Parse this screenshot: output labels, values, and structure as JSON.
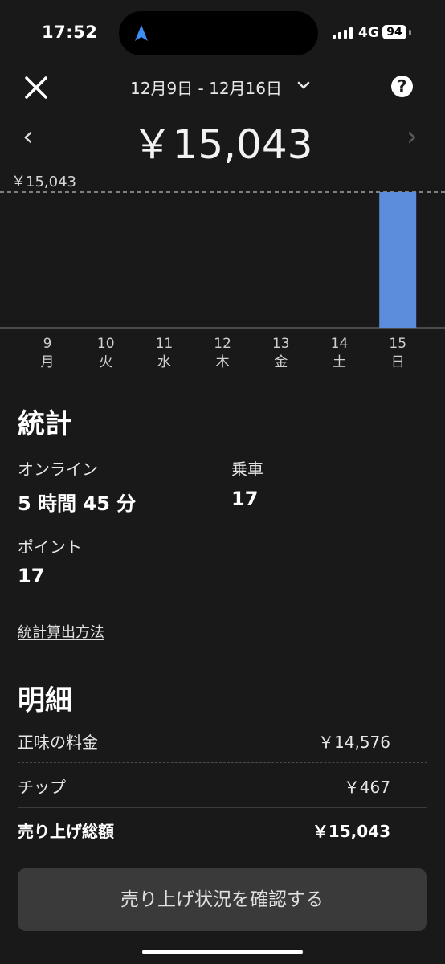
{
  "status_bar": {
    "time": "17:52",
    "network": "4G",
    "battery": "94"
  },
  "header": {
    "date_range": "12月9日 - 12月16日",
    "total": "￥15,043",
    "prev": "‹",
    "next": "›",
    "help": "?"
  },
  "chart_data": {
    "type": "bar",
    "categories": [
      "9",
      "10",
      "11",
      "12",
      "13",
      "14",
      "15"
    ],
    "weekdays": [
      "月",
      "火",
      "水",
      "木",
      "金",
      "土",
      "日"
    ],
    "values": [
      0,
      0,
      0,
      0,
      0,
      0,
      15043
    ],
    "max_label": "￥15,043",
    "ylim": [
      0,
      15043
    ],
    "bar_color": "#5b8ddc",
    "grid": false,
    "legend": "none"
  },
  "stats": {
    "title": "統計",
    "online_label": "オンライン",
    "online_value": "5 時間 45 分",
    "rides_label": "乗車",
    "rides_value": "17",
    "points_label": "ポイント",
    "points_value": "17",
    "method_link": "統計算出方法"
  },
  "breakdown": {
    "title": "明細",
    "rows": [
      {
        "label": "正味の料金",
        "value": "￥14,576"
      },
      {
        "label": "チップ",
        "value": "￥467"
      },
      {
        "label": "売り上げ総額",
        "value": "￥15,043"
      }
    ]
  },
  "action": {
    "label": "売り上げ状況を確認する"
  },
  "colors": {
    "background": "#191919",
    "accent_bar": "#5b8ddc",
    "button_bg": "#3a3a3a",
    "nav_arrow": "#3d8ef7"
  }
}
